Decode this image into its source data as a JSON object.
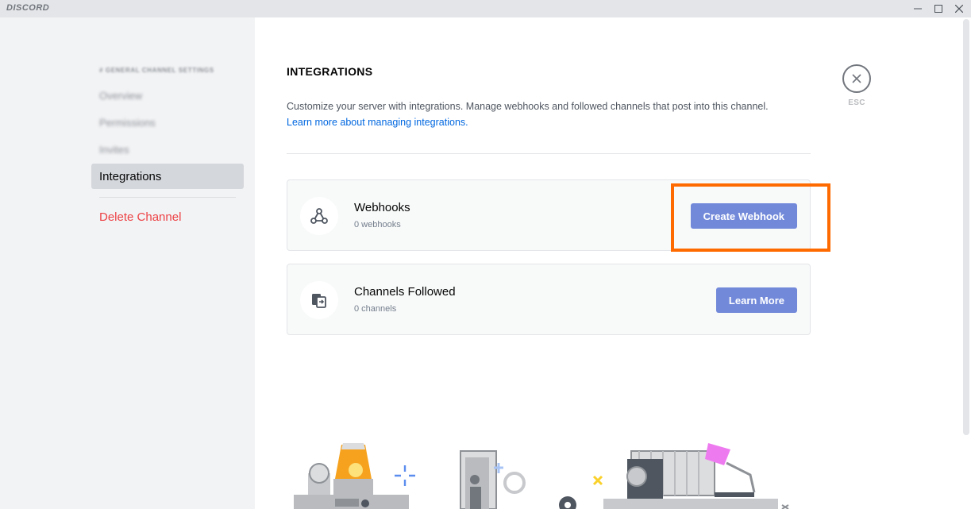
{
  "window": {
    "app_name": "DISCORD",
    "controls": [
      "minimize",
      "maximize",
      "close"
    ]
  },
  "sidebar": {
    "header": "# GENERAL  CHANNEL SETTINGS",
    "items": [
      {
        "label": "Overview",
        "blurred": true
      },
      {
        "label": "Permissions",
        "blurred": true
      },
      {
        "label": "Invites",
        "blurred": true
      },
      {
        "label": "Integrations",
        "selected": true
      },
      {
        "label": "Delete Channel",
        "danger": true
      }
    ]
  },
  "main": {
    "title": "INTEGRATIONS",
    "description": "Customize your server with integrations. Manage webhooks and followed channels that post into this channel.",
    "learn_more_link": "Learn more about managing integrations.",
    "close_label": "ESC",
    "cards": [
      {
        "title": "Webhooks",
        "subtitle": "0 webhooks",
        "button": "Create Webhook",
        "icon": "webhook-icon"
      },
      {
        "title": "Channels Followed",
        "subtitle": "0 channels",
        "button": "Learn More",
        "icon": "channels-followed-icon"
      }
    ]
  },
  "colors": {
    "accent": "#7289da",
    "danger": "#ed4245",
    "link": "#0067e0",
    "highlight": "#ff6a00"
  }
}
